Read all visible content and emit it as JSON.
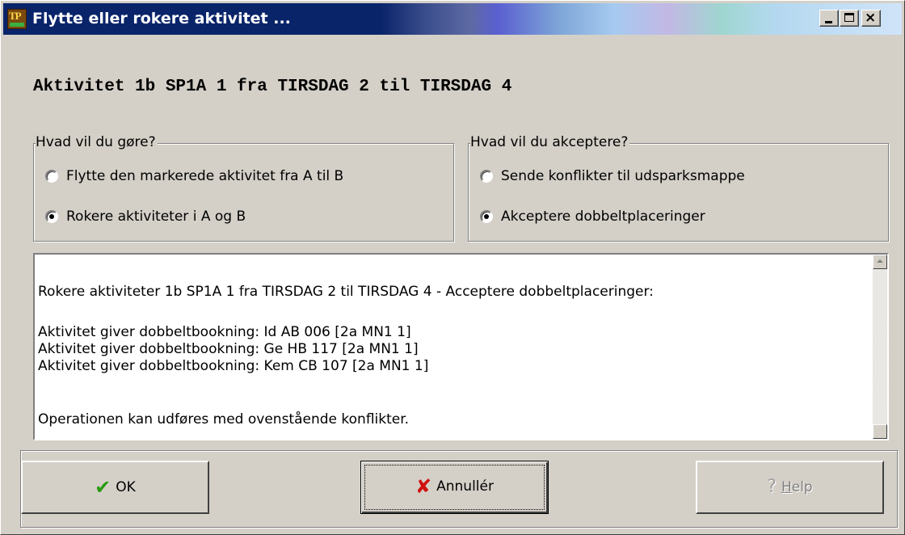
{
  "window": {
    "title": "Flytte eller rokere aktivitet ...",
    "app_icon_text": "TP",
    "controls": {
      "minimize": "_",
      "maximize": "□",
      "close": "×"
    }
  },
  "heading": "Aktivitet 1b SP1A 1 fra TIRSDAG 2 til TIRSDAG 4",
  "left_group": {
    "legend": "Hvad vil du gøre?",
    "options": [
      {
        "label": "Flytte den markerede aktivitet fra A til B",
        "selected": false
      },
      {
        "label": "Rokere aktiviteter i A og B",
        "selected": true
      }
    ]
  },
  "right_group": {
    "legend": "Hvad vil du akceptere?",
    "options": [
      {
        "label": "Sende konflikter til udsparksmappe",
        "selected": false
      },
      {
        "label": "Akceptere dobbeltplaceringer",
        "selected": true
      }
    ]
  },
  "messages": [
    "Rokere aktiviteter 1b SP1A 1 fra TIRSDAG 2 til TIRSDAG 4 - Acceptere dobbeltplaceringer:",
    "Aktivitet giver dobbeltbookning: Id AB 006 [2a MN1  1]",
    "Aktivitet giver dobbeltbookning: Ge HB 117 [2a MN1  1]",
    "Aktivitet giver dobbeltbookning: Kem CB 107 [2a MN1  1]",
    "Operationen kan udføres med ovenstående konflikter."
  ],
  "buttons": {
    "ok": {
      "label": "OK",
      "icon": "checkmark-icon"
    },
    "cancel": {
      "label": "Annullér",
      "icon": "x-icon"
    },
    "help": {
      "label_prefix": "",
      "label_underlined": "H",
      "label_rest": "elp",
      "icon": "question-icon"
    }
  }
}
